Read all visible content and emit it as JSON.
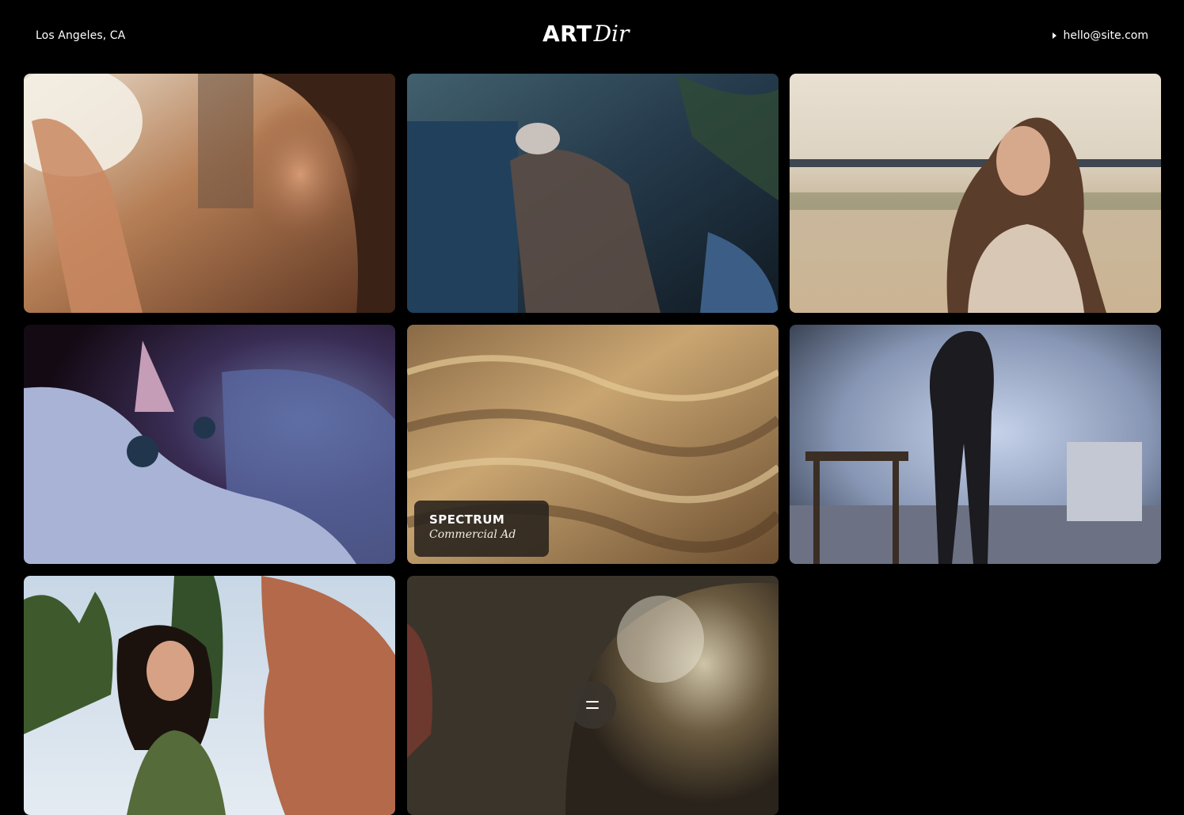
{
  "header": {
    "location": "Los Angeles, CA",
    "logo_primary": "ART",
    "logo_secondary": "Dir",
    "email": "hello@site.com"
  },
  "gallery": {
    "tiles": [
      {
        "id": 1,
        "subject": "woman-with-hat"
      },
      {
        "id": 2,
        "subject": "person-reclining-in-chair"
      },
      {
        "id": 3,
        "subject": "woman-on-beach"
      },
      {
        "id": 4,
        "subject": "sphynx-cat"
      },
      {
        "id": 5,
        "subject": "sand-dunes",
        "caption_title": "SPECTRUM",
        "caption_subtitle": "Commercial Ad"
      },
      {
        "id": 6,
        "subject": "man-in-studio"
      },
      {
        "id": 7,
        "subject": "women-laughing-outdoors"
      },
      {
        "id": 8,
        "subject": "glitter-face"
      }
    ]
  },
  "menu_button": {
    "icon": "menu-icon"
  }
}
